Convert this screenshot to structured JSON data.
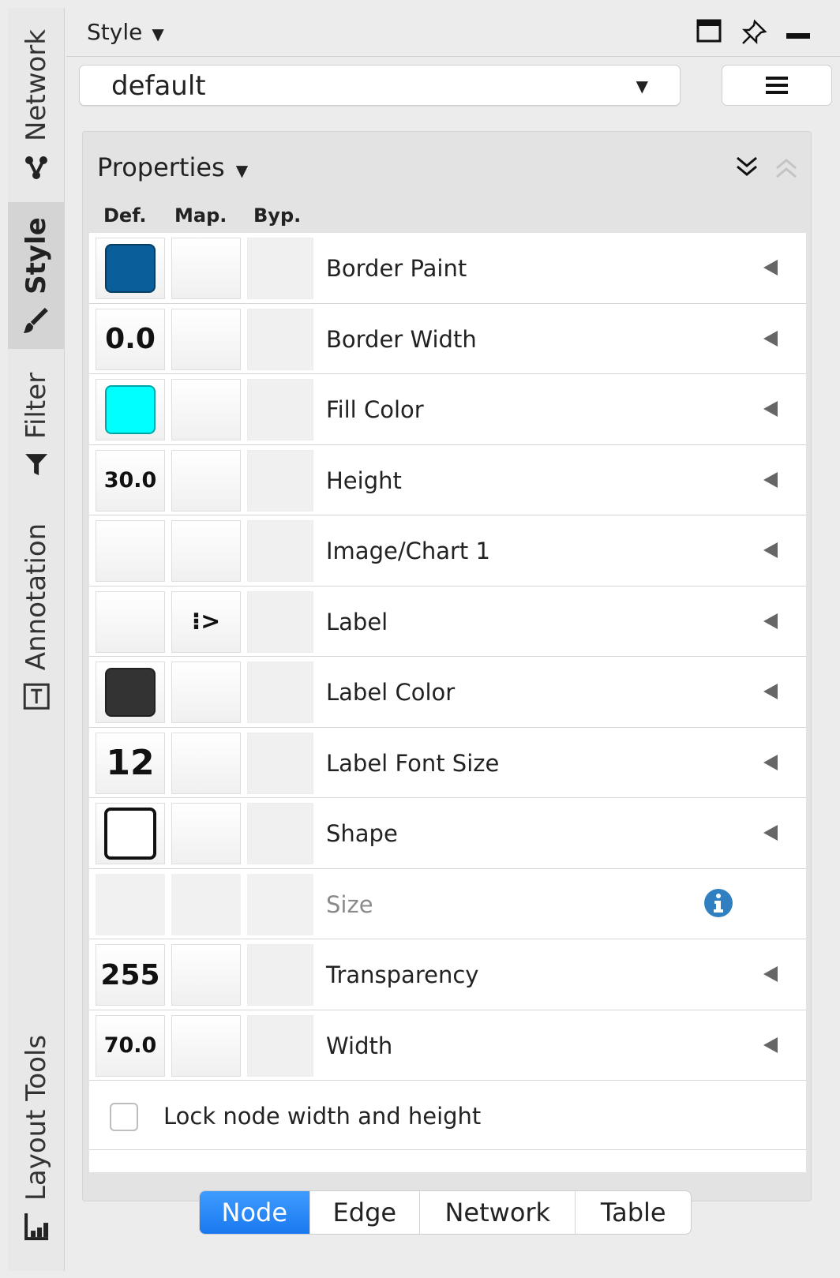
{
  "side_tabs": [
    {
      "label": "Network",
      "icon": "network-icon",
      "active": false
    },
    {
      "label": "Style",
      "icon": "paintbrush-icon",
      "active": true
    },
    {
      "label": "Filter",
      "icon": "funnel-icon",
      "active": false
    },
    {
      "label": "Annotation",
      "icon": "text-box-icon",
      "active": false
    },
    {
      "label": "Layout Tools",
      "icon": "layout-tools-icon",
      "active": false
    }
  ],
  "panel": {
    "title": "Style",
    "title_caret": "▼",
    "icons": [
      "float-window-icon",
      "pin-icon",
      "minimize-icon"
    ]
  },
  "style_selector": {
    "value": "default",
    "caret": "▼",
    "menu_icon": "hamburger-menu-icon"
  },
  "properties": {
    "title": "Properties",
    "caret": "▼",
    "columns": {
      "def": "Def.",
      "map": "Map.",
      "byp": "Byp."
    },
    "rows": [
      {
        "name": "Border Paint",
        "def_kind": "swatch",
        "def_color": "#0a5e9a"
      },
      {
        "name": "Border Width",
        "def_kind": "text",
        "def_text": "0.0",
        "def_size": "lg"
      },
      {
        "name": "Fill Color",
        "def_kind": "swatch",
        "def_color": "#00ffff"
      },
      {
        "name": "Height",
        "def_kind": "text",
        "def_text": "30.0",
        "def_size": "md"
      },
      {
        "name": "Image/Chart 1",
        "def_kind": "empty"
      },
      {
        "name": "Label",
        "def_kind": "empty",
        "map_icon": "passthrough-mapping-icon",
        "map_text": "⁝>"
      },
      {
        "name": "Label Color",
        "def_kind": "swatch",
        "def_color": "#333333"
      },
      {
        "name": "Label Font Size",
        "def_kind": "text",
        "def_text": "12",
        "def_size": "xl"
      },
      {
        "name": "Shape",
        "def_kind": "shape"
      },
      {
        "name": "Size",
        "def_kind": "empty",
        "disabled": true,
        "info_icon": "info-icon"
      },
      {
        "name": "Transparency",
        "def_kind": "text",
        "def_text": "255",
        "def_size": "lg"
      },
      {
        "name": "Width",
        "def_kind": "text",
        "def_text": "70.0",
        "def_size": "md"
      }
    ],
    "lock_label": "Lock node width and height",
    "lock_checked": false
  },
  "bottom_tabs": [
    {
      "label": "Node",
      "active": true
    },
    {
      "label": "Edge",
      "active": false
    },
    {
      "label": "Network",
      "active": false
    },
    {
      "label": "Table",
      "active": false
    }
  ],
  "colors": {
    "accent": "#1a78f0",
    "info": "#2f7fc1"
  }
}
